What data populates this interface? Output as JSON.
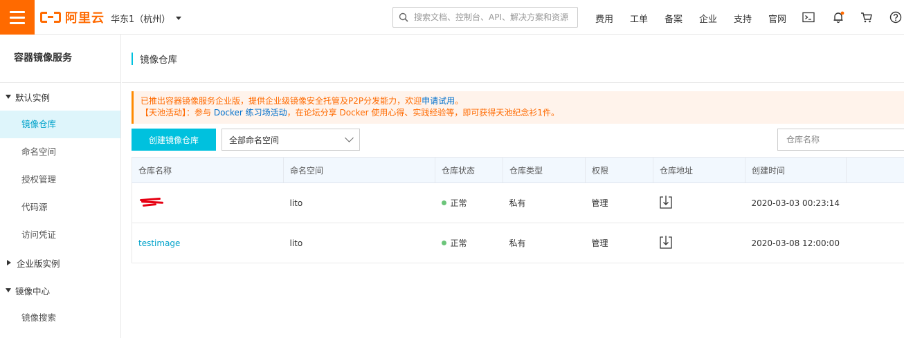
{
  "topbar": {
    "logo_text": "阿里云",
    "region": "华东1（杭州）",
    "search_placeholder": "搜索文档、控制台、API、解决方案和资源",
    "nav": [
      "费用",
      "工单",
      "备案",
      "企业",
      "支持",
      "官网"
    ],
    "icons": [
      "terminal-icon",
      "bell-icon",
      "cart-icon",
      "help-icon"
    ],
    "accent_color": "#ff6a00"
  },
  "sidebar": {
    "title": "容器镜像服务",
    "groups": [
      {
        "label": "默认实例",
        "expanded": true,
        "items": [
          "镜像仓库",
          "命名空间",
          "授权管理",
          "代码源",
          "访问凭证"
        ]
      },
      {
        "label": "企业版实例",
        "expanded": false,
        "items": []
      },
      {
        "label": "镜像中心",
        "expanded": true,
        "items": [
          "镜像搜索"
        ]
      }
    ],
    "active_item": "镜像仓库"
  },
  "page": {
    "title": "镜像仓库",
    "notice_line1_prefix": "已推出容器镜像服务企业版，提供企业级镜像安全托管及P2P分发能力，欢迎",
    "notice_line1_link": "申请试用",
    "notice_line1_suffix": "。",
    "notice_line2_prefix": "【天池活动】：参与 ",
    "notice_line2_link": "Docker 练习场活动",
    "notice_line2_suffix": "，在论坛分享 Docker 使用心得、实践经验等，即可获得天池纪念衫1件。",
    "create_button": "创建镜像仓库",
    "namespace_select": "全部命名空间",
    "repo_search_placeholder": "仓库名称"
  },
  "table": {
    "columns": [
      "仓库名称",
      "命名空间",
      "仓库状态",
      "仓库类型",
      "权限",
      "仓库地址",
      "创建时间",
      ""
    ],
    "rows": [
      {
        "name": "",
        "name_redacted": true,
        "namespace": "lito",
        "status": "正常",
        "type": "私有",
        "permission": "管理",
        "created": "2020-03-03 00:23:14"
      },
      {
        "name": "testimage",
        "name_redacted": false,
        "namespace": "lito",
        "status": "正常",
        "type": "私有",
        "permission": "管理",
        "created": "2020-03-08 12:00:00"
      }
    ],
    "status_color": "#6cc57a",
    "link_color": "#00a2ca"
  }
}
